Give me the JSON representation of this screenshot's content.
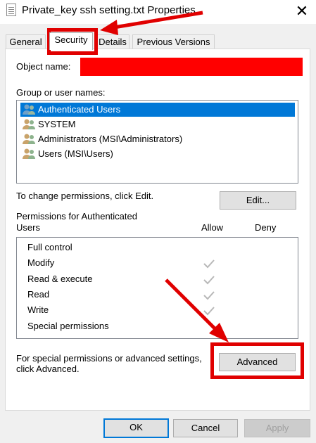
{
  "window": {
    "title": "Private_key ssh setting.txt Properties",
    "close_glyph": "✕"
  },
  "tabs": [
    {
      "label": "General"
    },
    {
      "label": "Security"
    },
    {
      "label": "Details"
    },
    {
      "label": "Previous Versions"
    }
  ],
  "security": {
    "object_name_label": "Object name:",
    "group_label": "Group or user names:",
    "users": [
      {
        "label": "Authenticated Users",
        "selected": true
      },
      {
        "label": "SYSTEM",
        "selected": false
      },
      {
        "label": "Administrators (MSI\\Administrators)",
        "selected": false
      },
      {
        "label": "Users (MSI\\Users)",
        "selected": false
      }
    ],
    "change_text": "To change permissions, click Edit.",
    "edit_label": "Edit...",
    "permissions_label_line1": "Permissions for Authenticated",
    "permissions_label_line2": "Users",
    "allow_label": "Allow",
    "deny_label": "Deny",
    "permissions": [
      {
        "name": "Full control",
        "allow": false
      },
      {
        "name": "Modify",
        "allow": true
      },
      {
        "name": "Read & execute",
        "allow": true
      },
      {
        "name": "Read",
        "allow": true
      },
      {
        "name": "Write",
        "allow": true
      },
      {
        "name": "Special permissions",
        "allow": false
      }
    ],
    "special_text_line1": "For special permissions or advanced settings,",
    "special_text_line2": "click Advanced.",
    "advanced_label": "Advanced"
  },
  "footer": {
    "ok_label": "OK",
    "cancel_label": "Cancel",
    "apply_label": "Apply"
  },
  "colors": {
    "annotation": "#e00000",
    "selection": "#0078d7"
  }
}
